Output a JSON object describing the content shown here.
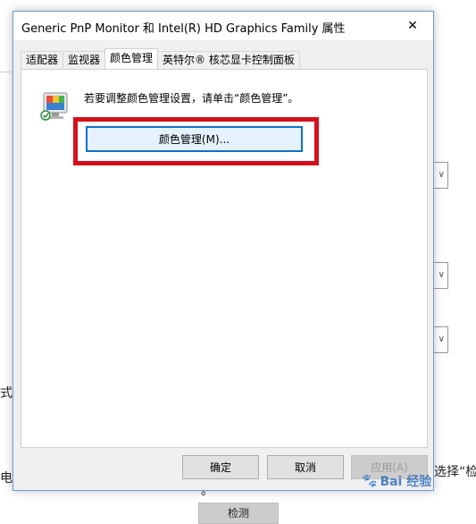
{
  "dialog": {
    "title": "Generic PnP Monitor 和 Intel(R) HD Graphics Family 属性",
    "close_glyph": "✕"
  },
  "tabs": [
    {
      "label": "适配器"
    },
    {
      "label": "监视器"
    },
    {
      "label": "颜色管理",
      "active": true
    },
    {
      "label": "英特尔® 核芯显卡控制面板"
    }
  ],
  "panel": {
    "instruction": "若要调整颜色管理设置，请单击“颜色管理”。",
    "color_management_button": "颜色管理(M)..."
  },
  "footer": {
    "ok": "确定",
    "cancel": "取消",
    "apply": "应用(A)"
  },
  "background": {
    "text_left_1": "式",
    "text_left_2": "电",
    "text_right": "选择“检测",
    "text_bottom": "。",
    "detect_button": "检测"
  },
  "watermark": {
    "text": "Bai  经验"
  }
}
